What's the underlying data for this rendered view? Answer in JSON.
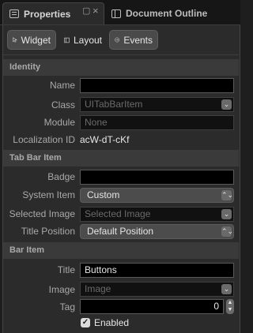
{
  "tabs": {
    "properties": "Properties",
    "document_outline": "Document Outline"
  },
  "tab_controls": {
    "float": "▢",
    "close": "×"
  },
  "segments": {
    "widget": "Widget",
    "layout": "Layout",
    "events": "Events"
  },
  "identity": {
    "header": "Identity",
    "name_label": "Name",
    "name_value": "",
    "class_label": "Class",
    "class_placeholder": "UITabBarItem",
    "module_label": "Module",
    "module_placeholder": "None",
    "localization_label": "Localization ID",
    "localization_value": "acW-dT-cKf"
  },
  "tab_bar_item": {
    "header": "Tab Bar Item",
    "badge_label": "Badge",
    "badge_value": "",
    "system_item_label": "System Item",
    "system_item_value": "Custom",
    "selected_image_label": "Selected Image",
    "selected_image_placeholder": "Selected Image",
    "title_position_label": "Title Position",
    "title_position_value": "Default Position"
  },
  "bar_item": {
    "header": "Bar Item",
    "title_label": "Title",
    "title_value": "Buttons",
    "image_label": "Image",
    "image_placeholder": "Image",
    "tag_label": "Tag",
    "tag_value": "0",
    "enabled_label": "Enabled",
    "enabled_checked": true
  },
  "glyphs": {
    "chevron_down": "⌄",
    "updown": "⌃⌄",
    "check": "✓"
  }
}
